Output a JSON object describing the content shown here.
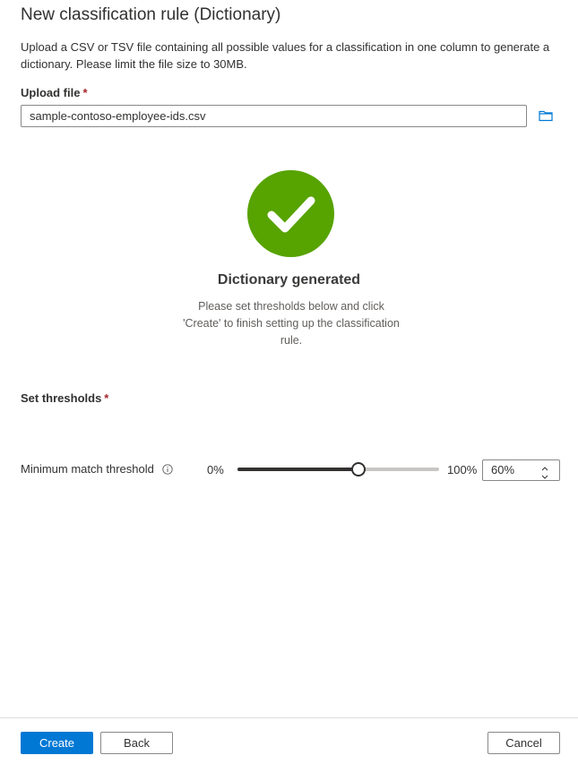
{
  "header": {
    "title": "New classification rule (Dictionary)",
    "description": "Upload a CSV or TSV file containing all possible values for a classification in one column to generate a dictionary. Please limit the file size to 30MB."
  },
  "upload": {
    "label": "Upload file",
    "required_mark": "*",
    "value": "sample-contoso-employee-ids.csv",
    "browse_icon": "folder-icon"
  },
  "status": {
    "icon": "checkmark-circle-icon",
    "color": "#57a300",
    "title": "Dictionary generated",
    "message": "Please set thresholds below and click 'Create' to finish setting up the classification rule."
  },
  "thresholds": {
    "label": "Set thresholds",
    "required_mark": "*",
    "minimum_match": {
      "label": "Minimum match threshold",
      "info_icon": "info-icon",
      "min_label": "0%",
      "max_label": "100%",
      "value": 60,
      "value_text": "60%"
    }
  },
  "footer": {
    "create_label": "Create",
    "back_label": "Back",
    "cancel_label": "Cancel",
    "primary_color": "#0078d4"
  }
}
